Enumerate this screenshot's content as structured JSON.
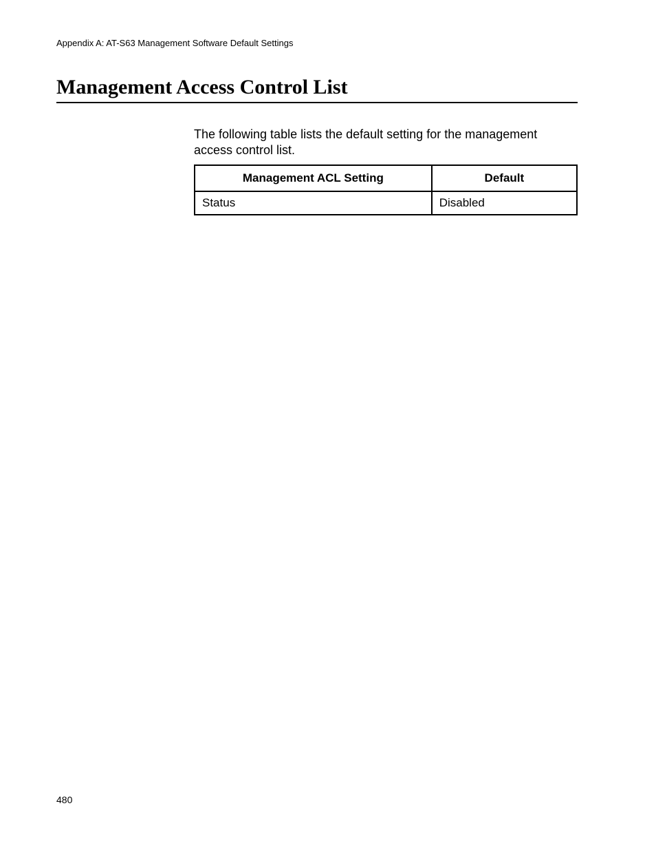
{
  "header": {
    "appendix_label": "Appendix A: AT-S63 Management Software Default Settings"
  },
  "section": {
    "title": "Management Access Control List",
    "intro": "The following table lists the default setting for the management access control list."
  },
  "table": {
    "headers": {
      "setting": "Management ACL Setting",
      "default": "Default"
    },
    "rows": [
      {
        "setting": "Status",
        "default": "Disabled"
      }
    ]
  },
  "footer": {
    "page_number": "480"
  }
}
